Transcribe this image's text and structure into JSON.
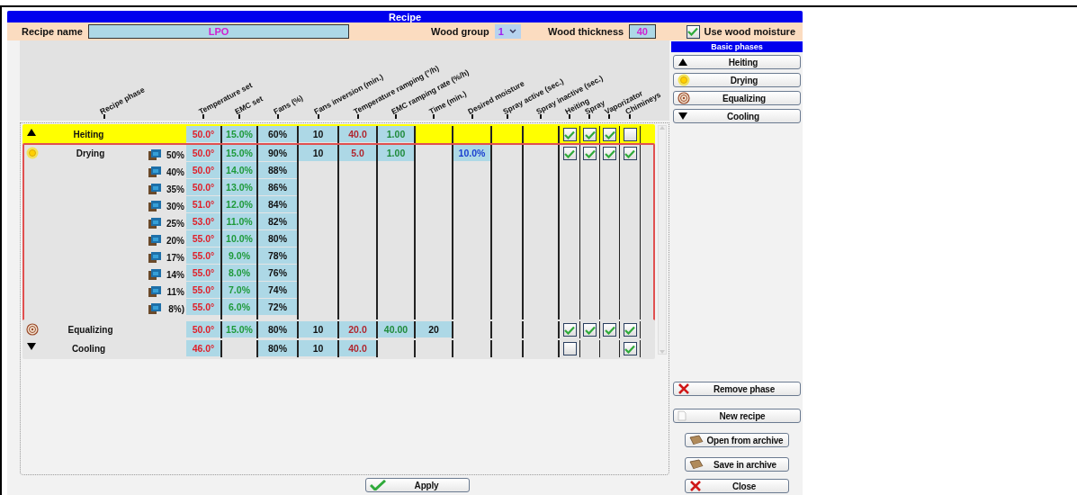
{
  "window": {
    "title": "Recipe"
  },
  "header": {
    "recipe_name_label": "Recipe name",
    "recipe_name": "LPO",
    "wood_group_label": "Wood group",
    "wood_group": "1",
    "wood_thickness_label": "Wood thickness",
    "wood_thickness": "40",
    "use_wood_moisture": {
      "label": "Use wood moisture",
      "checked": true
    }
  },
  "table": {
    "columns": [
      {
        "kind": "phase",
        "label": "Recipe phase"
      },
      {
        "kind": "value",
        "label": "Temperature set"
      },
      {
        "kind": "value",
        "label": "EMC set"
      },
      {
        "kind": "value",
        "label": "Fans (%)"
      },
      {
        "kind": "value",
        "label": "Fans inversion (min.)"
      },
      {
        "kind": "value",
        "label": "Temperature ramping (°/h)"
      },
      {
        "kind": "value",
        "label": "EMC ramping rate (%/h)"
      },
      {
        "kind": "value",
        "label": "Time (min.)"
      },
      {
        "kind": "value",
        "label": "Desired moisture"
      },
      {
        "kind": "value",
        "label": "Spray active (sec.)"
      },
      {
        "kind": "value",
        "label": "Spray inactive (sec.)"
      },
      {
        "kind": "check",
        "label": "Heiting"
      },
      {
        "kind": "check",
        "label": "Spray"
      },
      {
        "kind": "check",
        "label": "Vaporizator"
      },
      {
        "kind": "check",
        "label": "Chimineys"
      }
    ],
    "phases": [
      {
        "kind": "heating",
        "name": "Heiting",
        "selected": true,
        "checks": {
          "heating": true,
          "spray": true,
          "vaporizator": true,
          "chimneys": false
        },
        "rows": [
          {
            "temperature": "50.0°",
            "emc": "15.0%",
            "fans": "60%",
            "fans_inversion": "10",
            "temperature_ramping": "40.0",
            "emc_ramping": "1.00"
          }
        ]
      },
      {
        "kind": "drying",
        "name": "Drying",
        "selected": false,
        "checks": {
          "heating": true,
          "spray": true,
          "vaporizator": true,
          "chimneys": true
        },
        "rows": [
          {
            "moisture": "50%",
            "temperature": "50.0°",
            "emc": "15.0%",
            "fans": "90%",
            "fans_inversion": "10",
            "temperature_ramping": "5.0",
            "emc_ramping": "1.00",
            "desired_moisture": "10.0%"
          },
          {
            "moisture": "40%",
            "temperature": "50.0°",
            "emc": "14.0%",
            "fans": "88%"
          },
          {
            "moisture": "35%",
            "temperature": "50.0°",
            "emc": "13.0%",
            "fans": "86%"
          },
          {
            "moisture": "30%",
            "temperature": "51.0°",
            "emc": "12.0%",
            "fans": "84%"
          },
          {
            "moisture": "25%",
            "temperature": "53.0°",
            "emc": "11.0%",
            "fans": "82%"
          },
          {
            "moisture": "20%",
            "temperature": "55.0°",
            "emc": "10.0%",
            "fans": "80%"
          },
          {
            "moisture": "17%",
            "temperature": "55.0°",
            "emc": "9.0%",
            "fans": "78%"
          },
          {
            "moisture": "14%",
            "temperature": "55.0°",
            "emc": "8.0%",
            "fans": "76%"
          },
          {
            "moisture": "11%",
            "temperature": "55.0°",
            "emc": "7.0%",
            "fans": "74%"
          },
          {
            "moisture": "8%)",
            "temperature": "55.0°",
            "emc": "6.0%",
            "fans": "72%"
          }
        ]
      },
      {
        "kind": "equalizing",
        "name": "Equalizing",
        "selected": false,
        "checks": {
          "heating": true,
          "spray": true,
          "vaporizator": true,
          "chimneys": true
        },
        "rows": [
          {
            "temperature": "50.0°",
            "emc": "15.0%",
            "fans": "80%",
            "fans_inversion": "10",
            "temperature_ramping": "20.0",
            "emc_ramping": "40.00",
            "time": "20"
          }
        ]
      },
      {
        "kind": "cooling",
        "name": "Cooling",
        "selected": false,
        "checks": {
          "heating": false,
          "chimneys": true
        },
        "rows": [
          {
            "temperature": "46.0°",
            "fans": "80%",
            "fans_inversion": "10",
            "temperature_ramping": "40.0"
          }
        ]
      }
    ]
  },
  "basic_phases": {
    "title": "Basic phases",
    "buttons": [
      {
        "kind": "heating",
        "label": "Heiting"
      },
      {
        "kind": "drying",
        "label": "Drying"
      },
      {
        "kind": "equalizing",
        "label": "Equalizing"
      },
      {
        "kind": "cooling",
        "label": "Cooling"
      }
    ]
  },
  "actions": [
    {
      "kind": "remove",
      "label": "Remove phase"
    },
    {
      "kind": "new",
      "label": "New recipe"
    },
    {
      "kind": "open",
      "label": "Open from archive"
    },
    {
      "kind": "save",
      "label": "Save in archive"
    },
    {
      "kind": "close",
      "label": "Close"
    }
  ],
  "apply_button": {
    "label": "Apply"
  }
}
